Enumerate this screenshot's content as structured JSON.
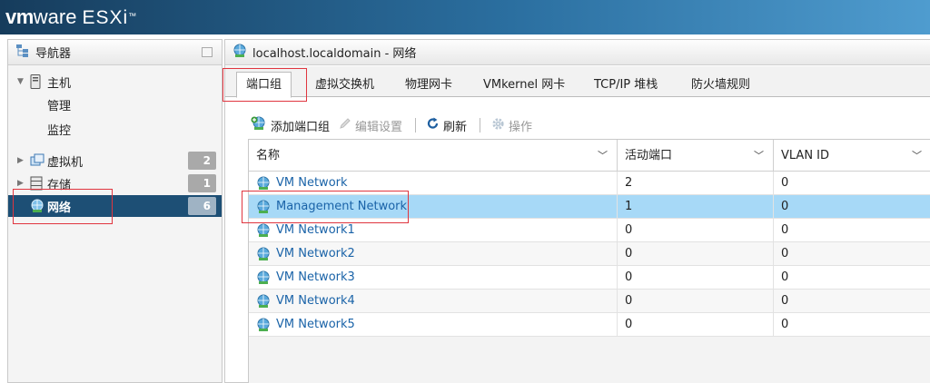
{
  "app": {
    "brand_vm": "vm",
    "brand_ware": "ware",
    "product": "ESXi",
    "trademark": "™"
  },
  "navigator": {
    "title": "导航器",
    "items": [
      {
        "label": "主机",
        "icon": "host-icon",
        "expanded": true
      },
      {
        "label": "管理",
        "sub": true
      },
      {
        "label": "监控",
        "sub": true
      },
      {
        "label": "虚拟机",
        "icon": "vm-icon",
        "badge": "2"
      },
      {
        "label": "存储",
        "icon": "storage-icon",
        "badge": "1"
      },
      {
        "label": "网络",
        "icon": "network-icon",
        "badge": "6",
        "selected": true
      }
    ]
  },
  "main": {
    "title": "localhost.localdomain - 网络",
    "tabs": [
      {
        "label": "端口组",
        "active": true
      },
      {
        "label": "虚拟交换机"
      },
      {
        "label": "物理网卡"
      },
      {
        "label": "VMkernel 网卡"
      },
      {
        "label": "TCP/IP 堆栈"
      },
      {
        "label": "防火墙规则"
      }
    ],
    "toolbar": {
      "add": "添加端口组",
      "edit": "编辑设置",
      "refresh": "刷新",
      "actions": "操作"
    },
    "table": {
      "columns": [
        "名称",
        "活动端口",
        "VLAN ID"
      ],
      "rows": [
        {
          "name": "VM Network",
          "ports": "2",
          "vlan": "0"
        },
        {
          "name": "Management Network",
          "ports": "1",
          "vlan": "0",
          "selected": true
        },
        {
          "name": "VM Network1",
          "ports": "0",
          "vlan": "0"
        },
        {
          "name": "VM Network2",
          "ports": "0",
          "vlan": "0"
        },
        {
          "name": "VM Network3",
          "ports": "0",
          "vlan": "0"
        },
        {
          "name": "VM Network4",
          "ports": "0",
          "vlan": "0"
        },
        {
          "name": "VM Network5",
          "ports": "0",
          "vlan": "0"
        }
      ]
    }
  },
  "colors": {
    "accent": "#1d4f75",
    "selection": "#a7d9f7",
    "highlight": "#e0353f",
    "link": "#1a63a8"
  }
}
